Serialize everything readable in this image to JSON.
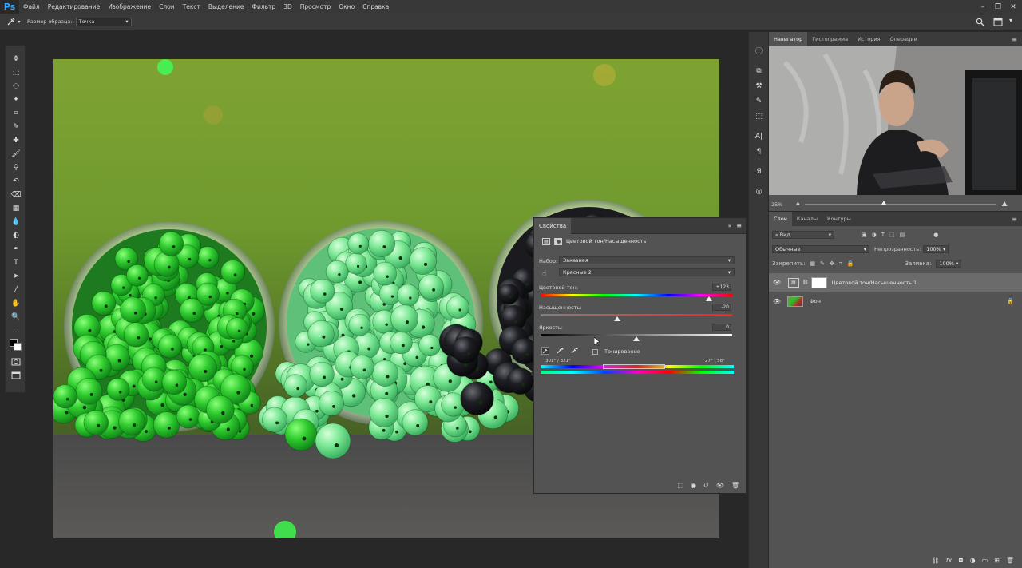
{
  "app": {
    "logo": "Ps",
    "menu": [
      "Файл",
      "Редактирование",
      "Изображение",
      "Слои",
      "Текст",
      "Выделение",
      "Фильтр",
      "3D",
      "Просмотр",
      "Окно",
      "Справка"
    ],
    "window_controls": [
      "–",
      "❐",
      "✕"
    ]
  },
  "options_bar": {
    "sample_size_label": "Размер образца:",
    "sample_size_value": "Точка"
  },
  "tools": [
    "move-tool",
    "marquee-tool",
    "lasso-tool",
    "quick-select-tool",
    "crop-tool",
    "eyedropper-tool",
    "healing-tool",
    "brush-tool",
    "stamp-tool",
    "history-brush-tool",
    "eraser-tool",
    "gradient-tool",
    "blur-tool",
    "dodge-tool",
    "pen-tool",
    "type-tool",
    "path-select-tool",
    "line-tool",
    "hand-tool",
    "zoom-tool",
    "more-tools"
  ],
  "properties": {
    "tab": "Свойства",
    "title": "Цветовой тон/Насыщенность",
    "preset_label": "Набор:",
    "preset_value": "Заказная",
    "channel_value": "Красные 2",
    "hue_label": "Цветовой тон:",
    "hue_value": "+123",
    "saturation_label": "Насыщенность:",
    "saturation_value": "-20",
    "lightness_label": "Яркость:",
    "lightness_value": "0",
    "colorize_label": "Тонирование",
    "range_left": "301° / 321°",
    "range_right": "27° \\ 58°",
    "hue_slider_pct": 0.88,
    "saturation_slider_pct": 0.4,
    "lightness_slider_pct": 0.5
  },
  "navigator": {
    "tabs": [
      "Навигатор",
      "Гистограмма",
      "История",
      "Операции"
    ],
    "zoom": "25%"
  },
  "layers": {
    "tabs": [
      "Слои",
      "Каналы",
      "Контуры"
    ],
    "kind_filter": "Вид",
    "blend_mode": "Обычные",
    "opacity_label": "Непрозрачность:",
    "opacity_value": "100%",
    "lock_label": "Закрепить:",
    "fill_label": "Заливка:",
    "fill_value": "100%",
    "items": [
      {
        "name": "Цветовой тон/Насыщенность 1"
      },
      {
        "name": "Фон"
      }
    ]
  }
}
